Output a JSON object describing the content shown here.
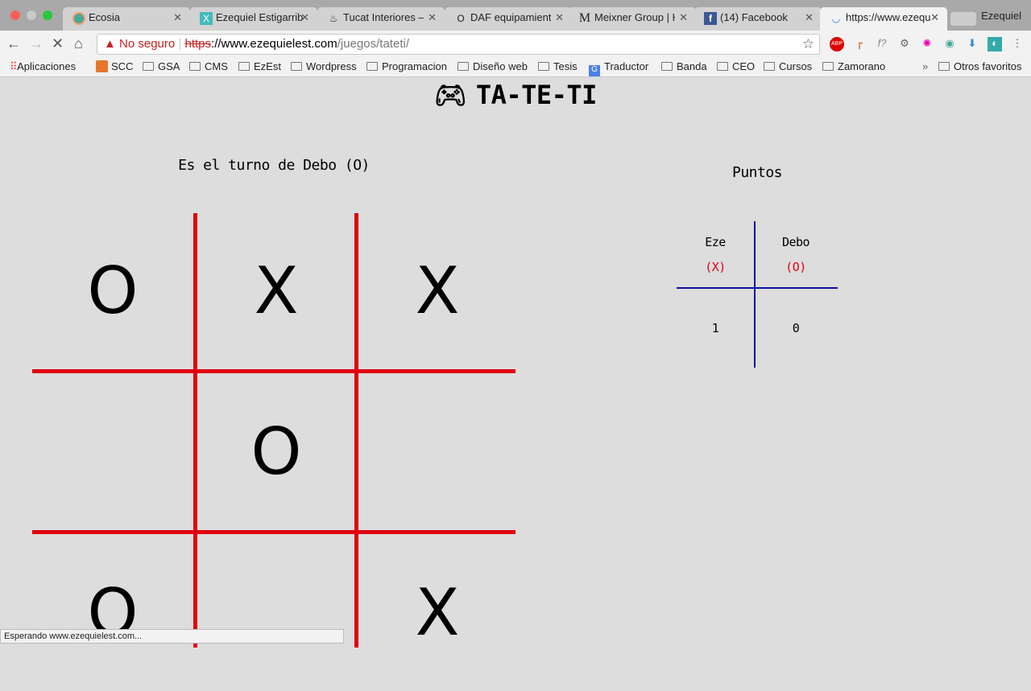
{
  "browser": {
    "tabs": [
      {
        "title": "Ecosia",
        "icon": "ecosia-icon"
      },
      {
        "title": "Ezequiel Estigarrib",
        "icon": "x-logo-icon"
      },
      {
        "title": "Tucat Interiores –",
        "icon": "tucat-icon"
      },
      {
        "title": "DAF equipamiento",
        "icon": "daf-icon"
      },
      {
        "title": "Meixner Group | H",
        "icon": "meixner-icon"
      },
      {
        "title": "(14) Facebook",
        "icon": "facebook-icon"
      },
      {
        "title": "https://www.ezequ",
        "icon": "loading-icon",
        "active": true
      }
    ],
    "profile": "Ezequiel",
    "security_label": "No seguro",
    "url_scheme": "https",
    "url_host": "://www.ezequielest.com",
    "url_path": "/juegos/tateti/",
    "bookmarks": [
      "Aplicaciones",
      "SCC",
      "GSA",
      "CMS",
      "EzEst",
      "Wordpress",
      "Programacion",
      "Diseño web",
      "Tesis",
      "Traductor",
      "Banda",
      "CEO",
      "Cursos",
      "Zamorano"
    ],
    "other_bookmarks": "Otros favoritos",
    "status_text": "Esperando www.ezequielest.com..."
  },
  "game": {
    "title": "TA-TE-TI",
    "turn_text": "Es el turno de Debo (O)",
    "board": [
      [
        "O",
        "X",
        "X"
      ],
      [
        "",
        "O",
        ""
      ],
      [
        "O",
        "",
        "X"
      ]
    ],
    "line_color": "#e00010"
  },
  "score": {
    "title": "Puntos",
    "players": [
      {
        "name": "Eze",
        "symbol": "(X)",
        "points": "1"
      },
      {
        "name": "Debo",
        "symbol": "(O)",
        "points": "0"
      }
    ],
    "line_color": "#1010a0"
  }
}
